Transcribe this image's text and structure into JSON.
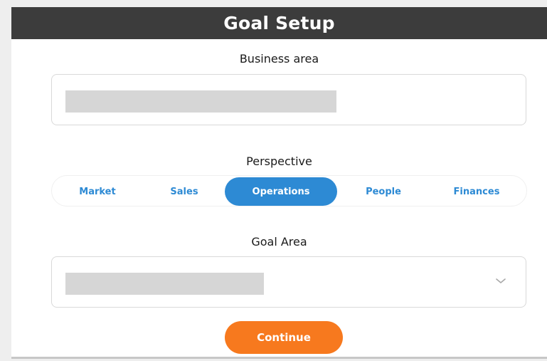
{
  "header": {
    "title": "Goal Setup"
  },
  "business_area": {
    "label": "Business area",
    "value": ""
  },
  "perspective": {
    "label": "Perspective",
    "options": [
      "Market",
      "Sales",
      "Operations",
      "People",
      "Finances"
    ],
    "selected": "Operations"
  },
  "goal_area": {
    "label": "Goal Area",
    "value": "",
    "dropdown_icon": "chevron-down-icon"
  },
  "actions": {
    "continue_label": "Continue"
  },
  "colors": {
    "header_bg": "#3c3c3c",
    "accent_blue": "#2d8ad4",
    "accent_orange": "#f7791e",
    "placeholder_gray": "#d6d6d6"
  }
}
